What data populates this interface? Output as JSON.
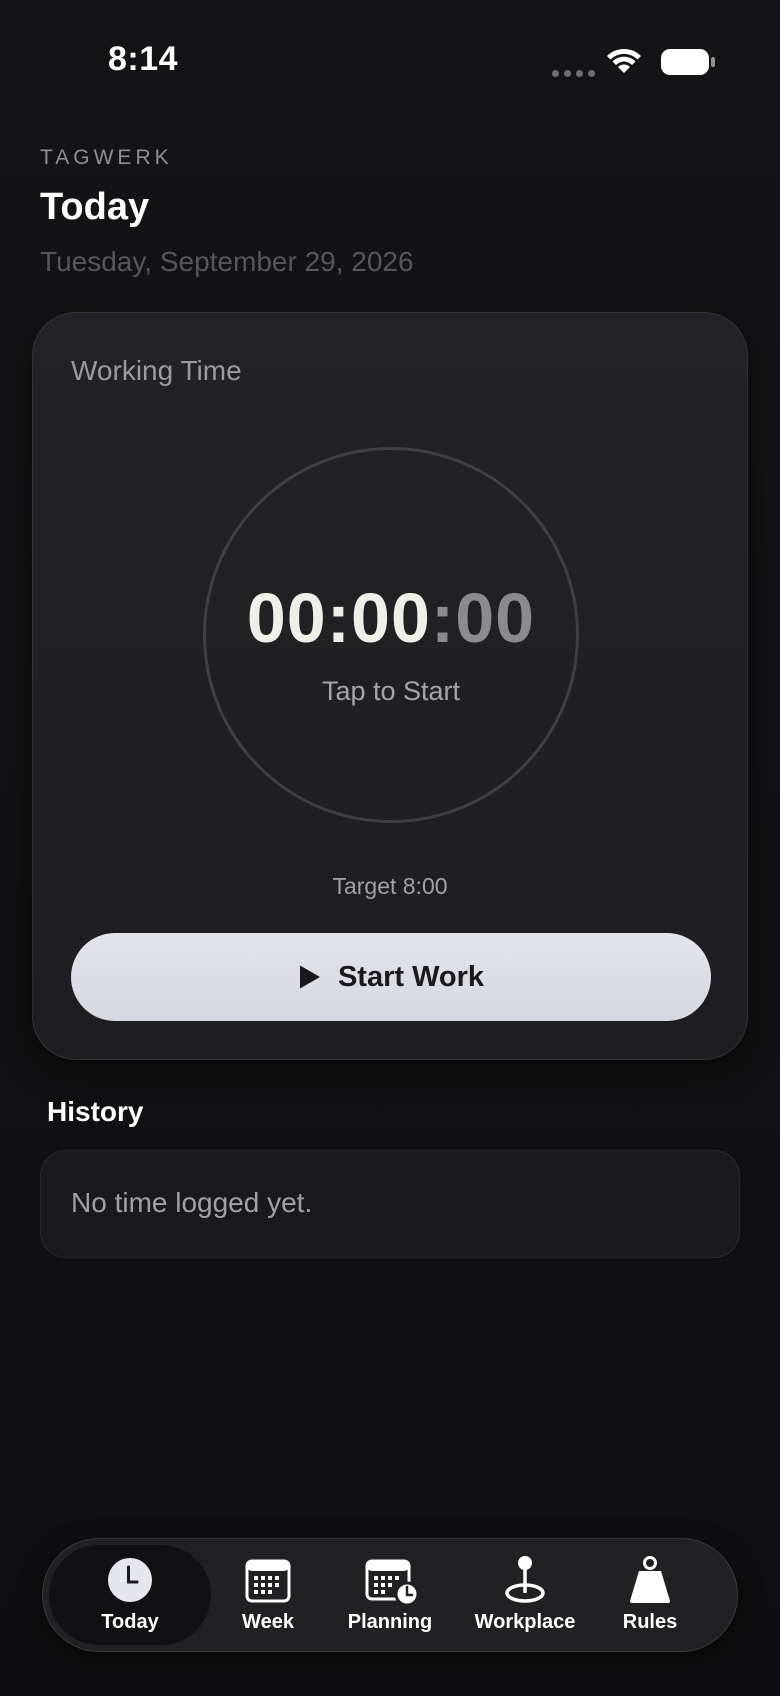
{
  "status_bar": {
    "time": "8:14"
  },
  "header": {
    "brand": "TAGWERK",
    "title": "Today",
    "date": "Tuesday, September 29, 2026"
  },
  "timer_card": {
    "label": "Working Time",
    "time_main": "00:00",
    "time_separator": ":",
    "time_seconds": "00",
    "hint": "Tap to Start",
    "target": "Target 8:00",
    "start_button_label": "Start Work"
  },
  "history": {
    "title": "History",
    "empty_message": "No time logged yet."
  },
  "tab_bar": {
    "active_tab": "Today",
    "tabs": [
      {
        "label": "Today",
        "icon": "clock-icon"
      },
      {
        "label": "Week",
        "icon": "calendar-icon"
      },
      {
        "label": "Planning",
        "icon": "calendar-clock-icon"
      },
      {
        "label": "Workplace",
        "icon": "location-pin-icon"
      },
      {
        "label": "Rules",
        "icon": "weight-icon"
      }
    ]
  },
  "colors": {
    "background": "#121214",
    "card": "#222225",
    "button": "#dcdde4",
    "text_primary": "#ffffff",
    "text_secondary": "#a1a1a6"
  }
}
